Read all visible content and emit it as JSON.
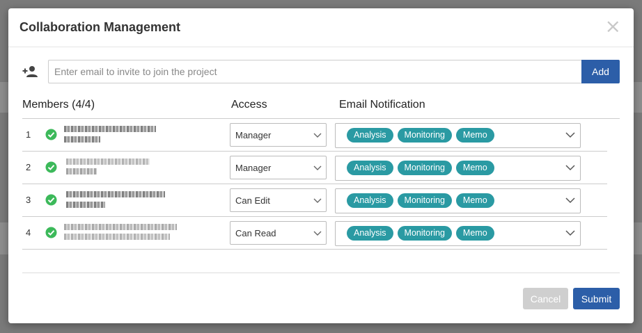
{
  "dialog": {
    "title": "Collaboration Management",
    "close_symbol": "×"
  },
  "invite": {
    "icon": "person-add-icon",
    "placeholder": "Enter email to invite to join the project",
    "add_label": "Add"
  },
  "table": {
    "headers": {
      "members": "Members (4/4)",
      "access": "Access",
      "email_notification": "Email Notification"
    },
    "rows": [
      {
        "index": "1",
        "status_icon": "check-circle-icon",
        "access": "Manager",
        "notifications": [
          "Analysis",
          "Monitoring",
          "Memo"
        ]
      },
      {
        "index": "2",
        "status_icon": "check-circle-icon",
        "access": "Manager",
        "notifications": [
          "Analysis",
          "Monitoring",
          "Memo"
        ]
      },
      {
        "index": "3",
        "status_icon": "check-circle-icon",
        "access": "Can Edit",
        "notifications": [
          "Analysis",
          "Monitoring",
          "Memo"
        ]
      },
      {
        "index": "4",
        "status_icon": "check-circle-icon",
        "access": "Can Read",
        "notifications": [
          "Analysis",
          "Monitoring",
          "Memo"
        ]
      }
    ]
  },
  "footer": {
    "cancel_label": "Cancel",
    "submit_label": "Submit"
  },
  "colors": {
    "primary": "#2c5ea8",
    "tag": "#2a9aa3",
    "success": "#3cb95a",
    "disabled": "#cfcfcf"
  }
}
